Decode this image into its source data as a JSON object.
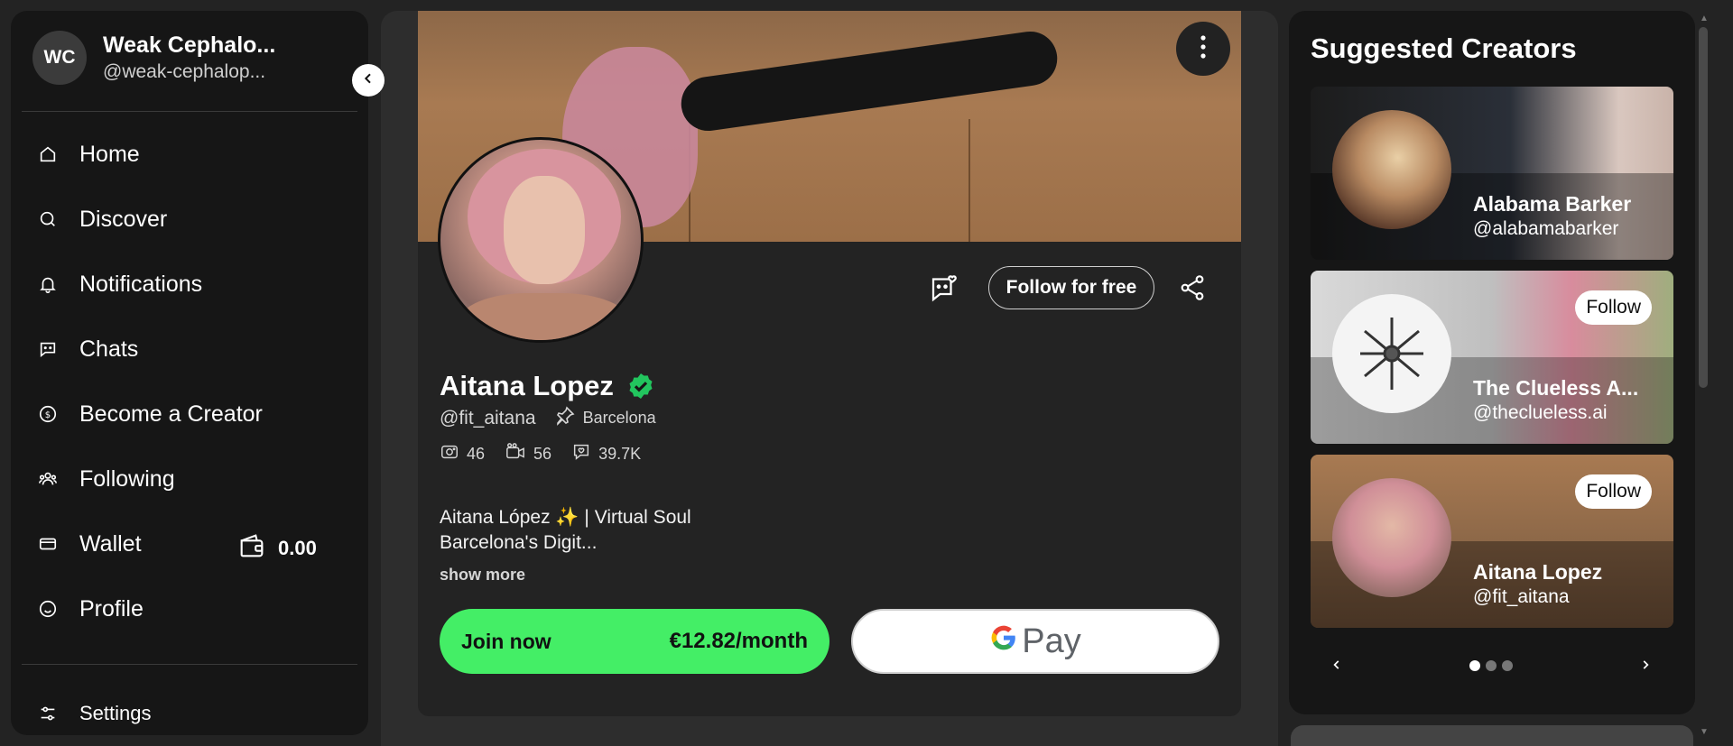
{
  "user": {
    "initials": "WC",
    "name": "Weak Cephalo...",
    "handle": "@weak-cephalop..."
  },
  "nav": {
    "home": "Home",
    "discover": "Discover",
    "notifications": "Notifications",
    "chats": "Chats",
    "become_creator": "Become a Creator",
    "following": "Following",
    "wallet": "Wallet",
    "wallet_balance": "0.00",
    "profile": "Profile",
    "settings": "Settings"
  },
  "profile": {
    "name": "Aitana Lopez",
    "handle": "@fit_aitana",
    "location": "Barcelona",
    "stats": {
      "photos": "46",
      "videos": "56",
      "likes": "39.7K"
    },
    "bio_line1": "Aitana López ✨ | Virtual Soul",
    "bio_line2": "Barcelona's Digit...",
    "show_more": "show more",
    "follow_label": "Follow for free",
    "join_label": "Join now",
    "join_price": "€12.82/month",
    "gpay_label": "Pay"
  },
  "suggested": {
    "title": "Suggested Creators",
    "follow_label": "Follow",
    "creators": [
      {
        "name": "Alabama Barker",
        "handle": "@alabamabarker"
      },
      {
        "name": "The Clueless A...",
        "handle": "@theclueless.ai"
      },
      {
        "name": "Aitana Lopez",
        "handle": "@fit_aitana"
      }
    ],
    "active_page": 1,
    "page_count": 3
  },
  "colors": {
    "accent_green": "#44ee66",
    "verified_green": "#22c55e",
    "sidebar_bg": "#161616"
  }
}
